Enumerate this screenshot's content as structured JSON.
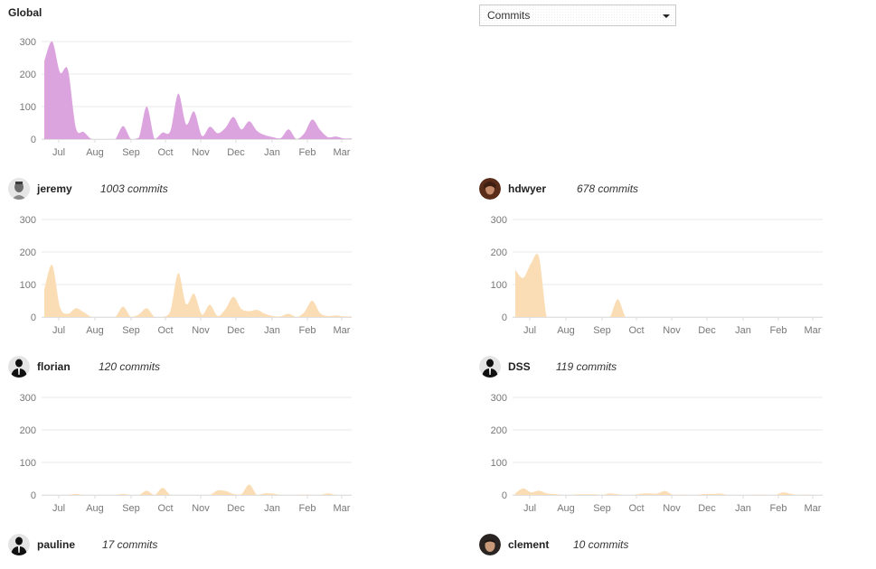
{
  "header": {
    "global_title": "Global",
    "metric_select": {
      "selected": "Commits"
    }
  },
  "colors": {
    "global_fill": "#dca4de",
    "user_fill": "#fbddb5",
    "grid": "#e8e8e8",
    "axis_text": "#777777"
  },
  "chart_data": [
    {
      "id": "global",
      "type": "area",
      "title": "Global",
      "xlabel": "",
      "ylabel": "",
      "ylim": [
        0,
        300
      ],
      "yticks": [
        0,
        100,
        200,
        300
      ],
      "grid": true,
      "x_tick_labels": [
        "Jul",
        "Aug",
        "Sep",
        "Oct",
        "Nov",
        "Dec",
        "Jan",
        "Feb",
        "Mar"
      ],
      "x_unit": "week index (0 = mid-June, 39 = mid-March)",
      "values": [
        240,
        300,
        205,
        213,
        35,
        22,
        0,
        0,
        0,
        0,
        40,
        0,
        5,
        100,
        0,
        20,
        25,
        140,
        45,
        85,
        10,
        38,
        18,
        35,
        68,
        30,
        55,
        25,
        12,
        6,
        3,
        30,
        0,
        18,
        60,
        28,
        6,
        8,
        2,
        2
      ]
    },
    {
      "id": "jeremy",
      "type": "area",
      "user": "jeremy",
      "commits_label": "1003 commits",
      "ylim": [
        0,
        300
      ],
      "yticks": [
        0,
        100,
        200,
        300
      ],
      "grid": true,
      "x_tick_labels": [
        "Jul",
        "Aug",
        "Sep",
        "Oct",
        "Nov",
        "Dec",
        "Jan",
        "Feb",
        "Mar"
      ],
      "values": [
        85,
        160,
        30,
        10,
        27,
        15,
        0,
        0,
        0,
        0,
        32,
        0,
        8,
        27,
        0,
        0,
        18,
        135,
        40,
        72,
        8,
        38,
        3,
        25,
        62,
        25,
        18,
        22,
        10,
        3,
        2,
        10,
        0,
        15,
        50,
        12,
        3,
        5,
        2,
        2
      ]
    },
    {
      "id": "hdwyer",
      "type": "area",
      "user": "hdwyer",
      "commits_label": "678 commits",
      "ylim": [
        0,
        300
      ],
      "yticks": [
        0,
        100,
        200,
        300
      ],
      "grid": true,
      "x_tick_labels": [
        "Jul",
        "Aug",
        "Sep",
        "Oct",
        "Nov",
        "Dec",
        "Jan",
        "Feb",
        "Mar"
      ],
      "values": [
        145,
        120,
        165,
        185,
        0,
        0,
        0,
        0,
        0,
        0,
        0,
        0,
        0,
        55,
        0,
        0,
        0,
        0,
        0,
        0,
        0,
        0,
        0,
        0,
        0,
        0,
        0,
        0,
        0,
        0,
        0,
        0,
        0,
        0,
        0,
        0,
        0,
        0,
        0,
        0
      ]
    },
    {
      "id": "florian",
      "type": "area",
      "user": "florian",
      "commits_label": "120 commits",
      "ylim": [
        0,
        300
      ],
      "yticks": [
        0,
        100,
        200,
        300
      ],
      "grid": true,
      "x_tick_labels": [
        "Jul",
        "Aug",
        "Sep",
        "Oct",
        "Nov",
        "Dec",
        "Jan",
        "Feb",
        "Mar"
      ],
      "values": [
        0,
        0,
        0,
        0,
        3,
        0,
        0,
        0,
        0,
        0,
        3,
        0,
        0,
        13,
        0,
        22,
        0,
        0,
        0,
        0,
        0,
        0,
        14,
        12,
        3,
        2,
        32,
        0,
        5,
        4,
        0,
        0,
        0,
        1,
        0,
        0,
        5,
        0,
        0,
        0
      ]
    },
    {
      "id": "dss",
      "type": "area",
      "user": "DSS",
      "commits_label": "119 commits",
      "ylim": [
        0,
        300
      ],
      "yticks": [
        0,
        100,
        200,
        300
      ],
      "grid": true,
      "x_tick_labels": [
        "Jul",
        "Aug",
        "Sep",
        "Oct",
        "Nov",
        "Dec",
        "Jan",
        "Feb",
        "Mar"
      ],
      "values": [
        5,
        20,
        8,
        13,
        5,
        3,
        0,
        0,
        2,
        2,
        2,
        0,
        5,
        2,
        0,
        0,
        4,
        5,
        4,
        12,
        0,
        1,
        0,
        0,
        3,
        3,
        4,
        0,
        0,
        0,
        0,
        1,
        0,
        0,
        8,
        3,
        0,
        1,
        0,
        0
      ]
    },
    {
      "id": "pauline",
      "type": "area",
      "user": "pauline",
      "commits_label": "17 commits"
    },
    {
      "id": "clement",
      "type": "area",
      "user": "clement",
      "commits_label": "10 commits"
    }
  ],
  "users": [
    {
      "name": "jeremy",
      "commits": "1003 commits",
      "avatar": "photo-gray"
    },
    {
      "name": "hdwyer",
      "commits": "678 commits",
      "avatar": "photo-brown"
    },
    {
      "name": "florian",
      "commits": "120 commits",
      "avatar": "default-silhouette"
    },
    {
      "name": "DSS",
      "commits": "119 commits",
      "avatar": "default-silhouette"
    },
    {
      "name": "pauline",
      "commits": "17 commits",
      "avatar": "default-silhouette"
    },
    {
      "name": "clement",
      "commits": "10 commits",
      "avatar": "photo-face"
    }
  ]
}
